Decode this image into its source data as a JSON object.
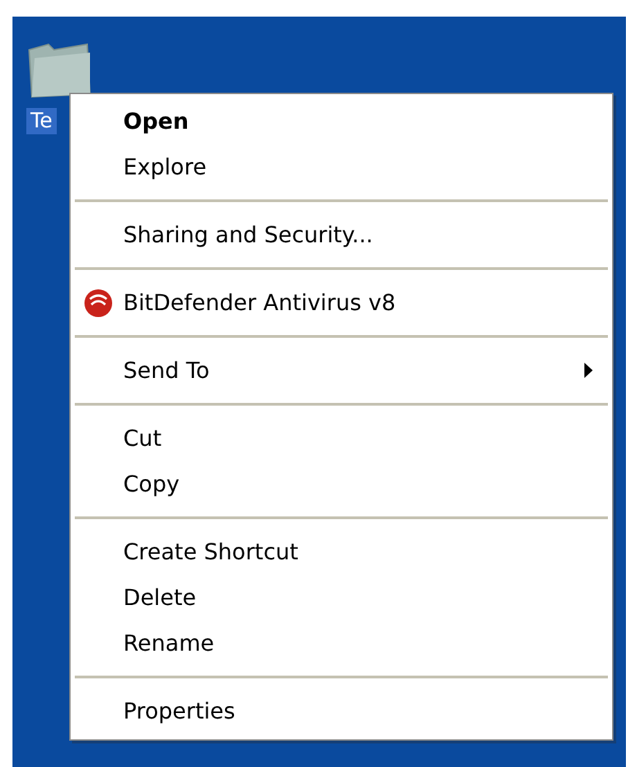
{
  "desktop_icon": {
    "label": "Te",
    "selected": true
  },
  "context_menu": {
    "items": [
      {
        "kind": "item",
        "label": "Open",
        "default": true
      },
      {
        "kind": "item",
        "label": "Explore",
        "default": false
      },
      {
        "kind": "separator"
      },
      {
        "kind": "item",
        "label": "Sharing and Security...",
        "default": false
      },
      {
        "kind": "separator"
      },
      {
        "kind": "item",
        "label": "BitDefender Antivirus v8",
        "default": false,
        "icon": true
      },
      {
        "kind": "separator"
      },
      {
        "kind": "item",
        "label": "Send To",
        "default": false,
        "submenu": true
      },
      {
        "kind": "separator"
      },
      {
        "kind": "item",
        "label": "Cut",
        "default": false
      },
      {
        "kind": "item",
        "label": "Copy",
        "default": false
      },
      {
        "kind": "separator"
      },
      {
        "kind": "item",
        "label": "Create Shortcut",
        "default": false
      },
      {
        "kind": "item",
        "label": "Delete",
        "default": false
      },
      {
        "kind": "item",
        "label": "Rename",
        "default": false
      },
      {
        "kind": "separator"
      },
      {
        "kind": "item",
        "label": "Properties",
        "default": false
      }
    ]
  }
}
